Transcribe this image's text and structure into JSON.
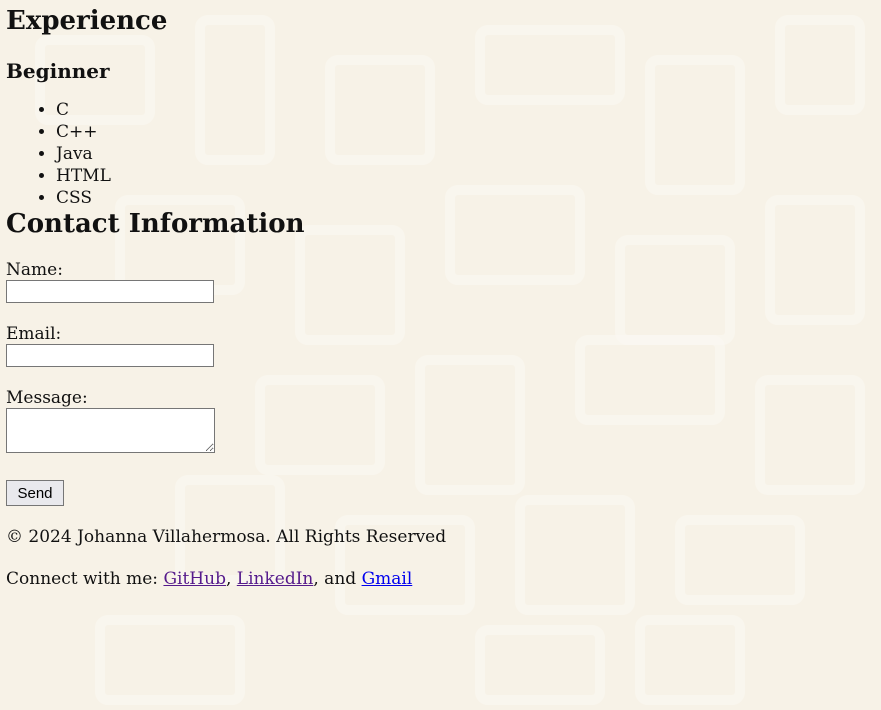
{
  "experience": {
    "title": "Experience",
    "level": "Beginner",
    "skills": [
      "C",
      "C++",
      "Java",
      "HTML",
      "CSS"
    ]
  },
  "contact": {
    "title": "Contact Information",
    "name_label": "Name:",
    "name_value": "",
    "email_label": "Email:",
    "email_value": "",
    "message_label": "Message:",
    "message_value": "",
    "send_label": "Send"
  },
  "footer": {
    "copyright": "© 2024 Johanna Villahermosa. All Rights Reserved",
    "connect_prefix": "Connect with me: ",
    "links": [
      {
        "label": "GitHub",
        "color": "#551a8b"
      },
      {
        "label": "LinkedIn",
        "color": "#551a8b"
      },
      {
        "label": "Gmail",
        "color": "#0000ee"
      }
    ],
    "separator_1": ", ",
    "separator_2": ", and "
  },
  "colors": {
    "background": "#f7f2e7"
  }
}
